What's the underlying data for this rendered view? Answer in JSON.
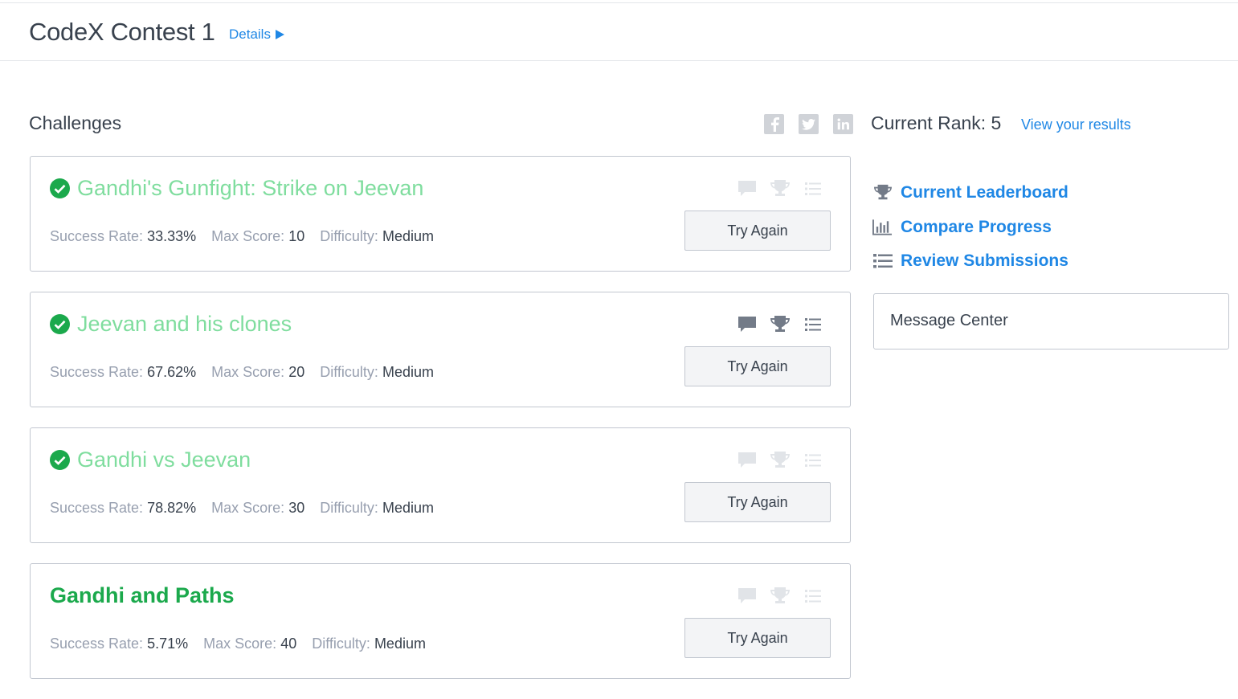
{
  "header": {
    "contest_title": "CodeX Contest 1",
    "details_label": "Details"
  },
  "challenges_section": {
    "title": "Challenges",
    "share_icons": [
      "facebook-icon",
      "twitter-icon",
      "linkedin-icon"
    ]
  },
  "sidebar": {
    "rank_label": "Current Rank: 5",
    "view_results_label": "View your results",
    "links": [
      {
        "label": "Current Leaderboard",
        "icon": "trophy-icon"
      },
      {
        "label": "Compare Progress",
        "icon": "bar-chart-icon"
      },
      {
        "label": "Review Submissions",
        "icon": "list-icon"
      }
    ],
    "message_center_label": "Message Center"
  },
  "meta_labels": {
    "success_rate": "Success Rate:",
    "max_score": "Max Score:",
    "difficulty": "Difficulty:"
  },
  "challenges": [
    {
      "name": "Gandhi's Gunfight: Strike on Jeevan",
      "solved": true,
      "success_rate": "33.33%",
      "max_score": "10",
      "difficulty": "Medium",
      "button_label": "Try Again",
      "icons_active": false
    },
    {
      "name": "Jeevan and his clones",
      "solved": true,
      "success_rate": "67.62%",
      "max_score": "20",
      "difficulty": "Medium",
      "button_label": "Try Again",
      "icons_active": true
    },
    {
      "name": "Gandhi vs Jeevan",
      "solved": true,
      "success_rate": "78.82%",
      "max_score": "30",
      "difficulty": "Medium",
      "button_label": "Try Again",
      "icons_active": false
    },
    {
      "name": "Gandhi and Paths",
      "solved": false,
      "success_rate": "5.71%",
      "max_score": "40",
      "difficulty": "Medium",
      "button_label": "Try Again",
      "icons_active": false
    }
  ],
  "colors": {
    "link_blue": "#1f87e5",
    "solved_green": "#1ba94c",
    "solved_title": "#7fdd9e",
    "icon_active": "#737b88",
    "icon_inactive": "#e1e4e8"
  }
}
